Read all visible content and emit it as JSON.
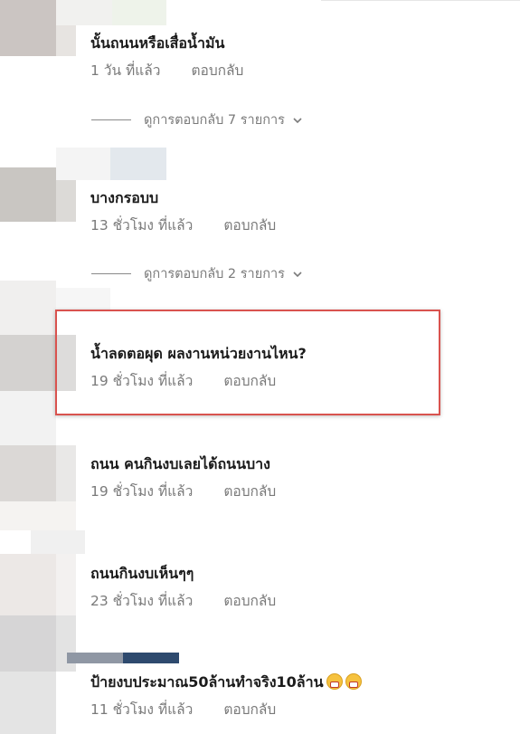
{
  "comments": [
    {
      "text": "นั้นถนนหรือเสื่อน้ำมัน",
      "time": "1 วัน ที่แล้ว",
      "reply": "ตอบกลับ",
      "replies_label": "ดูการตอบกลับ 7 รายการ"
    },
    {
      "text": "บางกรอบบ",
      "time": "13 ชั่วโมง ที่แล้ว",
      "reply": "ตอบกลับ",
      "replies_label": "ดูการตอบกลับ 2 รายการ"
    },
    {
      "text": "น้ำลดตอผุด ผลงานหน่วยงานไหน?",
      "time": "19 ชั่วโมง ที่แล้ว",
      "reply": "ตอบกลับ"
    },
    {
      "text": "ถนน คนกินงบเลยได้ถนนบาง",
      "time": "19 ชั่วโมง ที่แล้ว",
      "reply": "ตอบกลับ"
    },
    {
      "text": "ถนนกินงบเห็นๆๆ",
      "time": "23 ชั่วโมง ที่แล้ว",
      "reply": "ตอบกลับ"
    },
    {
      "text": "ป้ายงบประมาณ50ล้านทำจริง10ล้าน",
      "time": "11 ชั่วโมง ที่แล้ว",
      "reply": "ตอบกลับ",
      "emoji": [
        "grimacing-face-emoji",
        "grimacing-face-emoji"
      ]
    }
  ],
  "highlight_color": "#d9534f",
  "text_color": "#1b1b1b",
  "meta_color": "#7a7a7a"
}
